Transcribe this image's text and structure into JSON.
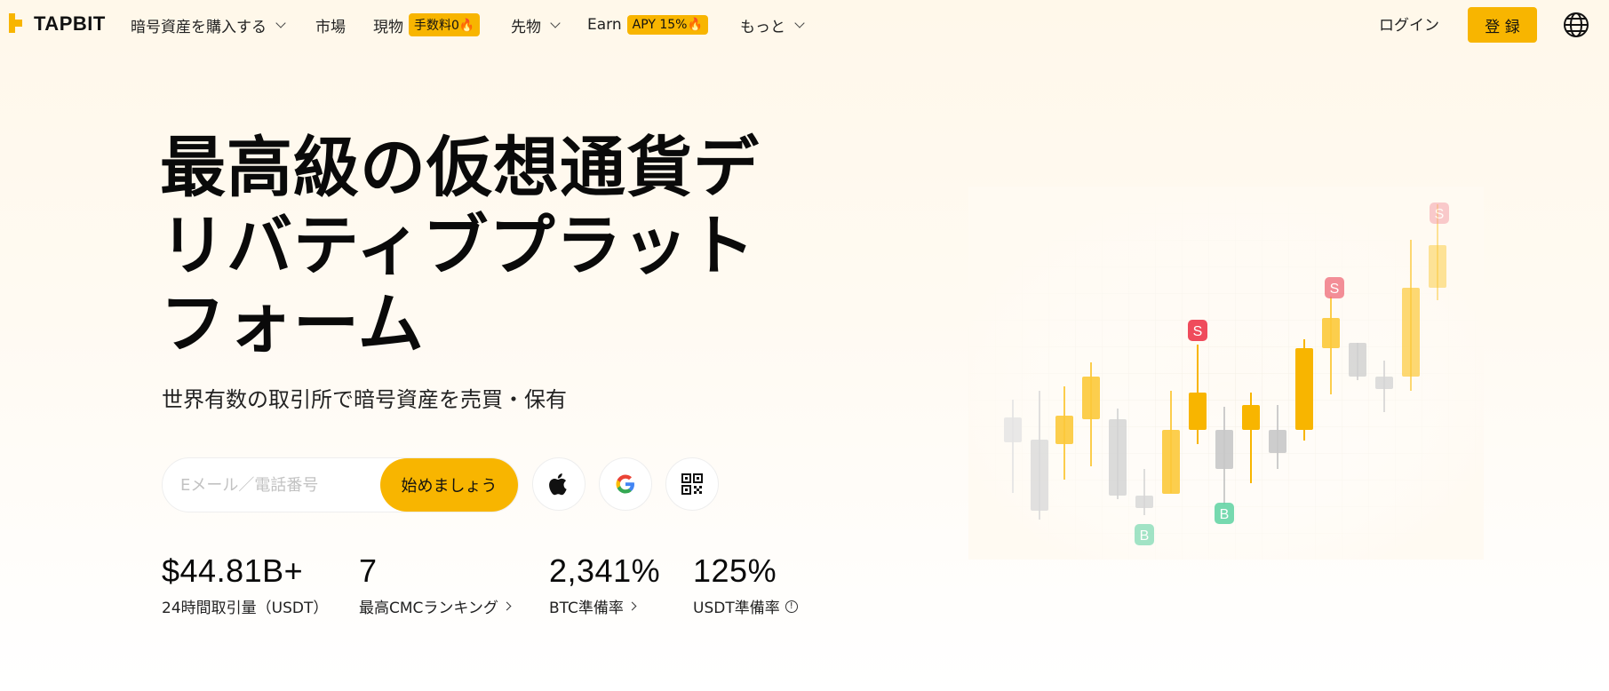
{
  "brand": {
    "name": "TAPBIT",
    "accent": "#f8b500"
  },
  "nav": {
    "items": [
      {
        "label": "暗号資産を購入する",
        "dropdown": true
      },
      {
        "label": "市場",
        "dropdown": false
      },
      {
        "label": "現物",
        "badge": "手数料0🔥",
        "dropdown": false
      },
      {
        "label": "先物",
        "dropdown": true
      },
      {
        "label": "Earn",
        "badge": "APY 15%🔥",
        "dropdown": false
      },
      {
        "label": "もっと",
        "dropdown": true
      }
    ],
    "login": "ログイン",
    "register": "登 録",
    "language_icon": "globe-icon"
  },
  "hero": {
    "title_lines": [
      "最高級の仮想通貨デ",
      "リバティブプラット",
      "フォーム"
    ],
    "subtitle": "世界有数の取引所で暗号資産を売買・保有",
    "input_placeholder": "Eメール／電話番号",
    "cta": "始めましょう",
    "login_icons": [
      "apple-icon",
      "google-icon",
      "qr-code-icon"
    ]
  },
  "stats": [
    {
      "value": "$44.81B+",
      "label": "24時間取引量（USDT）",
      "suffix_icon": ""
    },
    {
      "value": "7",
      "label": "最高CMCランキング",
      "suffix_icon": "chevron-right-icon"
    },
    {
      "value": "2,341%",
      "label": "BTC準備率",
      "suffix_icon": "chevron-right-icon"
    },
    {
      "value": "125%",
      "label": "USDT準備率",
      "suffix_icon": "info-icon"
    }
  ],
  "illustration": {
    "markers": [
      "S",
      "S",
      "S",
      "B",
      "B"
    ]
  }
}
